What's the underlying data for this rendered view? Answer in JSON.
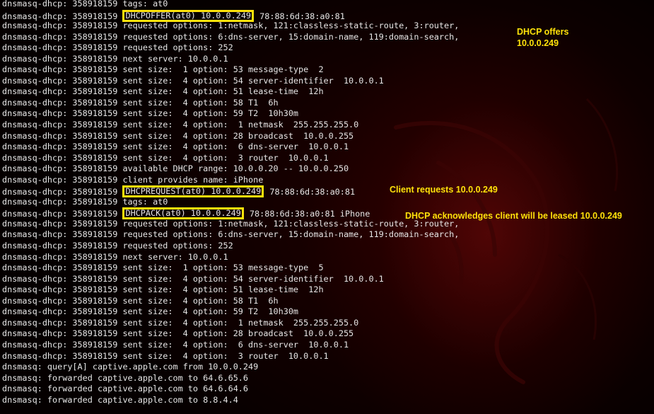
{
  "log_lines": [
    {
      "prefix": "dnsmasq-dhcp: 358918159 tags: at0"
    },
    {
      "prefix": "dnsmasq-dhcp: 358918159 ",
      "highlight": "DHCPOFFER(at0) 10.0.0.249",
      "suffix": " 78:88:6d:38:a0:81"
    },
    {
      "prefix": "dnsmasq-dhcp: 358918159 requested options: 1:netmask, 121:classless-static-route, 3:router,"
    },
    {
      "prefix": "dnsmasq-dhcp: 358918159 requested options: 6:dns-server, 15:domain-name, 119:domain-search,"
    },
    {
      "prefix": "dnsmasq-dhcp: 358918159 requested options: 252"
    },
    {
      "prefix": "dnsmasq-dhcp: 358918159 next server: 10.0.0.1"
    },
    {
      "prefix": "dnsmasq-dhcp: 358918159 sent size:  1 option: 53 message-type  2"
    },
    {
      "prefix": "dnsmasq-dhcp: 358918159 sent size:  4 option: 54 server-identifier  10.0.0.1"
    },
    {
      "prefix": "dnsmasq-dhcp: 358918159 sent size:  4 option: 51 lease-time  12h"
    },
    {
      "prefix": "dnsmasq-dhcp: 358918159 sent size:  4 option: 58 T1  6h"
    },
    {
      "prefix": "dnsmasq-dhcp: 358918159 sent size:  4 option: 59 T2  10h30m"
    },
    {
      "prefix": "dnsmasq-dhcp: 358918159 sent size:  4 option:  1 netmask  255.255.255.0"
    },
    {
      "prefix": "dnsmasq-dhcp: 358918159 sent size:  4 option: 28 broadcast  10.0.0.255"
    },
    {
      "prefix": "dnsmasq-dhcp: 358918159 sent size:  4 option:  6 dns-server  10.0.0.1"
    },
    {
      "prefix": "dnsmasq-dhcp: 358918159 sent size:  4 option:  3 router  10.0.0.1"
    },
    {
      "prefix": "dnsmasq-dhcp: 358918159 available DHCP range: 10.0.0.20 -- 10.0.0.250"
    },
    {
      "prefix": "dnsmasq-dhcp: 358918159 client provides name: iPhone"
    },
    {
      "prefix": "dnsmasq-dhcp: 358918159 ",
      "highlight": "DHCPREQUEST(at0) 10.0.0.249",
      "suffix": " 78:88:6d:38:a0:81"
    },
    {
      "prefix": "dnsmasq-dhcp: 358918159 tags: at0"
    },
    {
      "prefix": "dnsmasq-dhcp: 358918159 ",
      "highlight": "DHCPACK(at0) 10.0.0.249",
      "suffix": " 78:88:6d:38:a0:81 iPhone"
    },
    {
      "prefix": "dnsmasq-dhcp: 358918159 requested options: 1:netmask, 121:classless-static-route, 3:router,"
    },
    {
      "prefix": "dnsmasq-dhcp: 358918159 requested options: 6:dns-server, 15:domain-name, 119:domain-search,"
    },
    {
      "prefix": "dnsmasq-dhcp: 358918159 requested options: 252"
    },
    {
      "prefix": "dnsmasq-dhcp: 358918159 next server: 10.0.0.1"
    },
    {
      "prefix": "dnsmasq-dhcp: 358918159 sent size:  1 option: 53 message-type  5"
    },
    {
      "prefix": "dnsmasq-dhcp: 358918159 sent size:  4 option: 54 server-identifier  10.0.0.1"
    },
    {
      "prefix": "dnsmasq-dhcp: 358918159 sent size:  4 option: 51 lease-time  12h"
    },
    {
      "prefix": "dnsmasq-dhcp: 358918159 sent size:  4 option: 58 T1  6h"
    },
    {
      "prefix": "dnsmasq-dhcp: 358918159 sent size:  4 option: 59 T2  10h30m"
    },
    {
      "prefix": "dnsmasq-dhcp: 358918159 sent size:  4 option:  1 netmask  255.255.255.0"
    },
    {
      "prefix": "dnsmasq-dhcp: 358918159 sent size:  4 option: 28 broadcast  10.0.0.255"
    },
    {
      "prefix": "dnsmasq-dhcp: 358918159 sent size:  4 option:  6 dns-server  10.0.0.1"
    },
    {
      "prefix": "dnsmasq-dhcp: 358918159 sent size:  4 option:  3 router  10.0.0.1"
    },
    {
      "prefix": "dnsmasq: query[A] captive.apple.com from 10.0.0.249"
    },
    {
      "prefix": "dnsmasq: forwarded captive.apple.com to 64.6.65.6"
    },
    {
      "prefix": "dnsmasq: forwarded captive.apple.com to 64.6.64.6"
    },
    {
      "prefix": "dnsmasq: forwarded captive.apple.com to 8.8.4.4"
    }
  ],
  "annotations": {
    "offer_line1": "DHCP offers",
    "offer_line2": "10.0.0.249",
    "request": "Client requests 10.0.0.249",
    "ack": "DHCP acknowledges client will be leased 10.0.0.249"
  },
  "colors": {
    "terminal_text": "#e6e6e6",
    "highlight_box": "#ffe20a",
    "annotation_text": "#ffe20a",
    "background": "#050000",
    "background_glow": "#780a0a"
  },
  "icons": {
    "background_art": "kali-dragon-wallpaper"
  }
}
